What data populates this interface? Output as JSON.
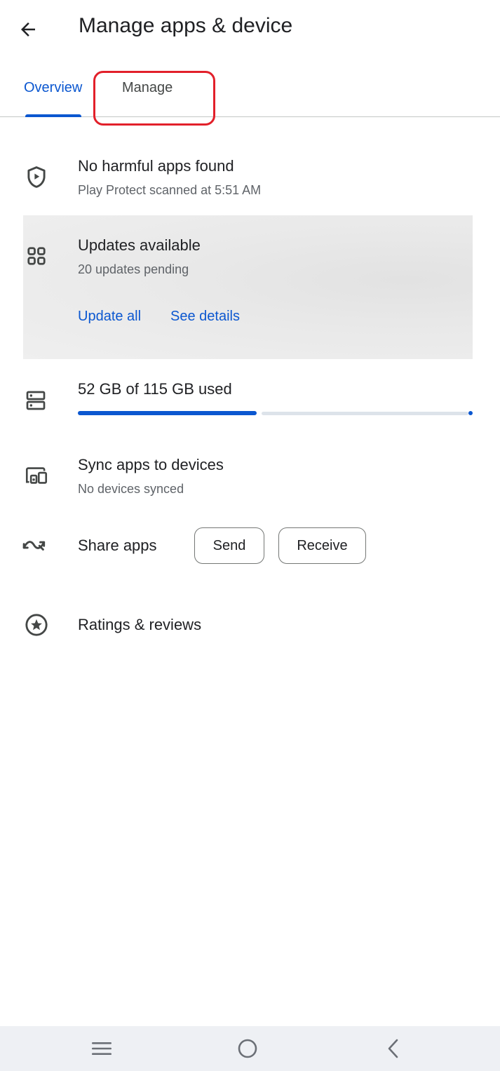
{
  "header": {
    "title": "Manage apps & device",
    "back_icon": "arrow-back-icon"
  },
  "tabs": [
    {
      "label": "Overview",
      "selected": true
    },
    {
      "label": "Manage",
      "selected": false
    }
  ],
  "protect": {
    "icon": "shield-play-icon",
    "title": "No harmful apps found",
    "subtitle": "Play Protect scanned at 5:51 AM"
  },
  "updates": {
    "icon": "apps-grid-icon",
    "title": "Updates available",
    "subtitle": "20 updates pending",
    "update_all_label": "Update all",
    "see_details_label": "See details"
  },
  "storage": {
    "icon": "storage-icon",
    "label": "52 GB of 115 GB used",
    "used_gb": 52,
    "total_gb": 115
  },
  "sync": {
    "icon": "devices-icon",
    "title": "Sync apps to devices",
    "subtitle": "No devices synced"
  },
  "share": {
    "icon": "share-apps-icon",
    "title": "Share apps",
    "send_label": "Send",
    "receive_label": "Receive"
  },
  "ratings": {
    "icon": "star-circle-icon",
    "title": "Ratings & reviews"
  },
  "colors": {
    "accent": "#0b57d0",
    "highlight": "#e2202a",
    "card_bg": "#ececec"
  },
  "system_nav": {
    "recents_icon": "menu-lines-icon",
    "home_icon": "home-circle-icon",
    "back_icon": "chevron-left-icon"
  }
}
